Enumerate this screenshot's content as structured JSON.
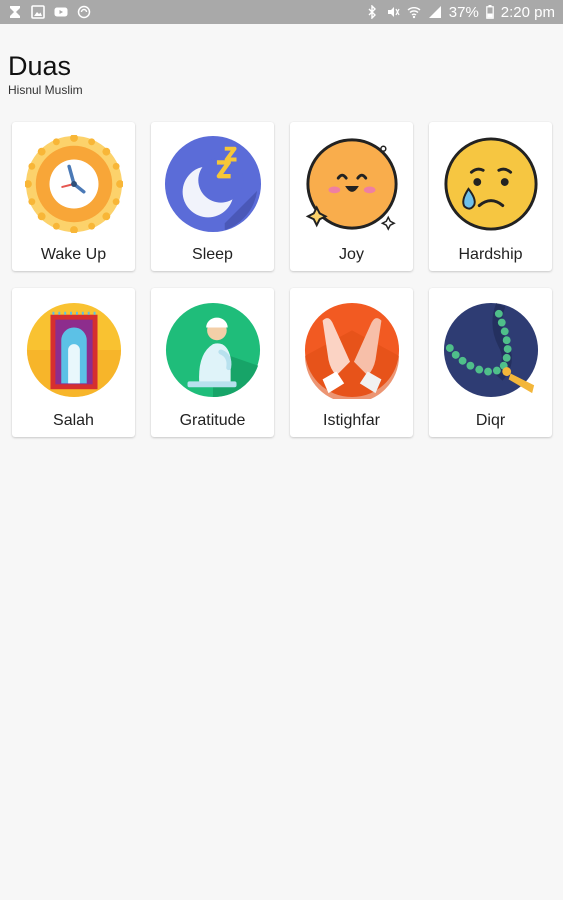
{
  "status_bar": {
    "battery": "37%",
    "time": "2:20 pm",
    "background_color": "#a9a9a9",
    "left_icons": [
      "hourglass-icon",
      "gallery-icon",
      "youtube-icon",
      "sync-icon"
    ],
    "right_icons": [
      "bluetooth-icon",
      "mute-icon",
      "wifi-icon",
      "signal-icon",
      "battery-icon"
    ]
  },
  "header": {
    "title": "Duas",
    "subtitle": "Hisnul Muslim"
  },
  "categories": [
    {
      "label": "Wake Up",
      "icon": "clock-sun-icon"
    },
    {
      "label": "Sleep",
      "icon": "moon-zzz-icon"
    },
    {
      "label": "Joy",
      "icon": "happy-face-icon"
    },
    {
      "label": "Hardship",
      "icon": "sad-face-icon"
    },
    {
      "label": "Salah",
      "icon": "prayer-mat-icon"
    },
    {
      "label": "Gratitude",
      "icon": "praying-man-icon"
    },
    {
      "label": "Istighfar",
      "icon": "praying-hands-icon"
    },
    {
      "label": "Diqr",
      "icon": "prayer-beads-icon"
    }
  ]
}
